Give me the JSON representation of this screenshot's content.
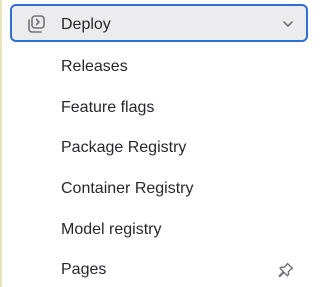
{
  "section": {
    "label": "Deploy",
    "icon": "deploy-icon",
    "expand_icon": "chevron-down-icon"
  },
  "items": [
    {
      "label": "Releases"
    },
    {
      "label": "Feature flags"
    },
    {
      "label": "Package Registry"
    },
    {
      "label": "Container Registry"
    },
    {
      "label": "Model registry"
    },
    {
      "label": "Pages",
      "pin_icon": "thumbtack-icon"
    }
  ],
  "colors": {
    "focus_ring": "#2f6fd0",
    "header_bg": "#ececef",
    "text": "#28272d",
    "icon": "#737278"
  }
}
